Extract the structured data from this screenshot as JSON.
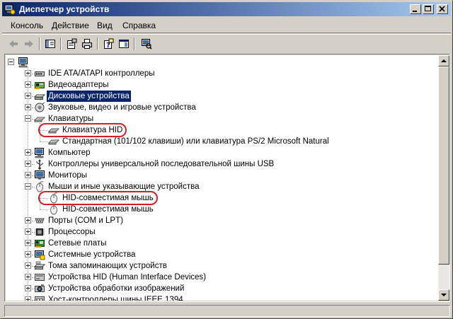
{
  "window": {
    "title": "Диспетчер устройств"
  },
  "menu": {
    "items": [
      "Консоль",
      "Действие",
      "Вид",
      "Справка"
    ]
  },
  "toolbar": {
    "buttons": [
      "back-arrow-icon",
      "forward-arrow-icon",
      "tree-view-icon",
      "properties-icon",
      "print-icon",
      "help-icon",
      "show-hide-icon",
      "scan-hardware-icon"
    ]
  },
  "tree": {
    "categories": [
      {
        "label": "IDE ATA/ATAPI контроллеры",
        "icon": "ide-controller-icon",
        "expanded": false
      },
      {
        "label": "Видеоадаптеры",
        "icon": "display-adapter-icon",
        "expanded": false
      },
      {
        "label": "Дисковые устройства",
        "icon": "disk-drive-icon",
        "expanded": false,
        "selected": true
      },
      {
        "label": "Звуковые, видео и игровые устройства",
        "icon": "sound-icon",
        "expanded": false
      },
      {
        "label": "Клавиатуры",
        "icon": "keyboard-icon",
        "expanded": true,
        "children": [
          {
            "label": "Клавиатура HID",
            "icon": "keyboard-icon",
            "highlighted": true
          },
          {
            "label": "Стандартная (101/102 клавиши) или клавиатура PS/2 Microsoft Natural",
            "icon": "keyboard-icon"
          }
        ]
      },
      {
        "label": "Компьютер",
        "icon": "computer-icon",
        "expanded": false
      },
      {
        "label": "Контроллеры универсальной последовательной шины USB",
        "icon": "usb-icon",
        "expanded": false
      },
      {
        "label": "Мониторы",
        "icon": "monitor-icon",
        "expanded": false
      },
      {
        "label": "Мыши и иные указывающие устройства",
        "icon": "mouse-icon",
        "expanded": true,
        "children": [
          {
            "label": "HID-совместимая мышь",
            "icon": "mouse-icon",
            "highlighted": true
          },
          {
            "label": "HID-совместимая мышь",
            "icon": "mouse-icon"
          }
        ]
      },
      {
        "label": "Порты (COM и LPT)",
        "icon": "port-icon",
        "expanded": false
      },
      {
        "label": "Процессоры",
        "icon": "processor-icon",
        "expanded": false
      },
      {
        "label": "Сетевые платы",
        "icon": "network-adapter-icon",
        "expanded": false
      },
      {
        "label": "Системные устройства",
        "icon": "system-device-icon",
        "expanded": false
      },
      {
        "label": "Тома запоминающих устройств",
        "icon": "storage-volume-icon",
        "expanded": false
      },
      {
        "label": "Устройства HID (Human Interface Devices)",
        "icon": "hid-device-icon",
        "expanded": false
      },
      {
        "label": "Устройства обработки изображений",
        "icon": "imaging-device-icon",
        "expanded": false
      },
      {
        "label": "Хост-контроллеры шины IEEE 1394",
        "icon": "ieee1394-icon",
        "expanded": false
      }
    ]
  },
  "colors": {
    "title_start": "#0a246a",
    "title_end": "#a6caf0",
    "selection": "#0a246a",
    "annotation": "#d21f2a",
    "face": "#d4d0c8"
  }
}
